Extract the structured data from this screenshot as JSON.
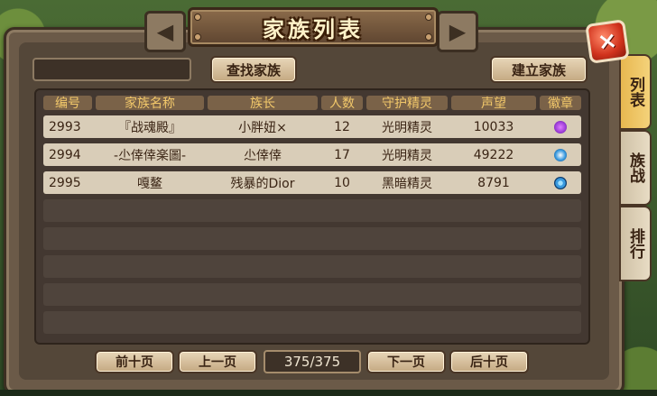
{
  "window": {
    "title": "家族列表"
  },
  "toolbar": {
    "search_label": "查找家族",
    "create_label": "建立家族",
    "search_value": ""
  },
  "close_glyph": "×",
  "table": {
    "headers": [
      "编号",
      "家族名称",
      "族长",
      "人数",
      "守护精灵",
      "声望",
      "徽章"
    ],
    "rows": [
      {
        "id": "2993",
        "name": "『战魂殿』",
        "leader": "小胖妞×",
        "members": "12",
        "spirit": "光明精灵",
        "prestige": "10033",
        "badge": "purple-flame-badge"
      },
      {
        "id": "2994",
        "name": "-尐倖倖楽圖-",
        "leader": "尐倖倖",
        "members": "17",
        "spirit": "光明精灵",
        "prestige": "49222",
        "badge": "blue-snowflake-badge"
      },
      {
        "id": "2995",
        "name": "嘎鳌",
        "leader": "残暴的Dior",
        "members": "10",
        "spirit": "黑暗精灵",
        "prestige": "8791",
        "badge": "blue-target-badge"
      }
    ]
  },
  "pagination": {
    "first_label": "前十页",
    "prev_label": "上一页",
    "page_text": "375/375",
    "next_label": "下一页",
    "last_label": "后十页"
  },
  "side_tabs": [
    {
      "label": "列表",
      "active": true
    },
    {
      "label": "族战",
      "active": false
    },
    {
      "label": "排行",
      "active": false
    }
  ],
  "colors": {
    "header_text": "#f2c86a",
    "row_bg": "#d9cdb8",
    "badge_purple": "#9b3cd6",
    "badge_blue": "#3a9adf"
  }
}
